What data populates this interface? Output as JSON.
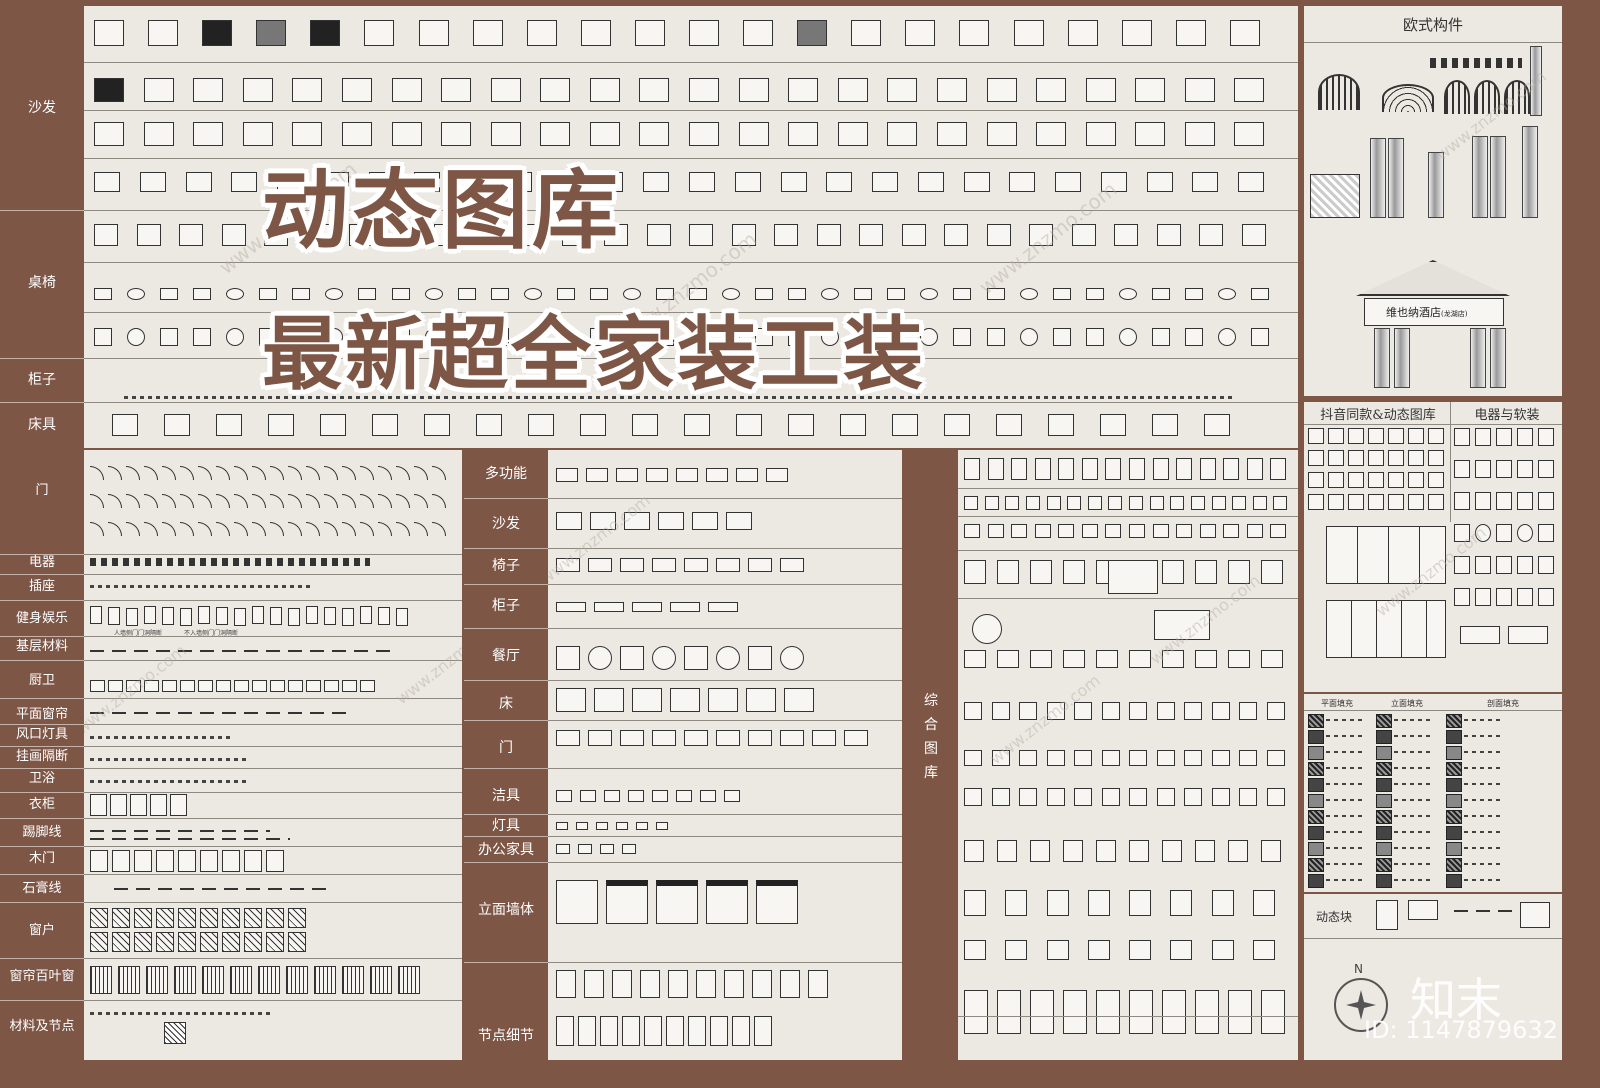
{
  "hero": {
    "line1": "动态图库",
    "line2": "最新超全家装工装"
  },
  "topleft_labels": [
    "沙发",
    "桌椅",
    "柜子",
    "床具"
  ],
  "midleft_labels": [
    "门",
    "电器",
    "插座",
    "健身娱乐",
    "基层材料",
    "厨卫",
    "平面窗帘",
    "风口灯具",
    "挂画隔断",
    "卫浴",
    "衣柜",
    "踢脚线",
    "木门",
    "石膏线",
    "窗户",
    "窗帘百叶窗",
    "材料及节点"
  ],
  "middle_labels": [
    "多功能",
    "沙发",
    "椅子",
    "柜子",
    "餐厅",
    "床",
    "门",
    "洁具",
    "灯具",
    "办公家具",
    "立面墙体",
    "节点细节"
  ],
  "mid_sign": [
    "综",
    "合",
    "图",
    "库"
  ],
  "right_titles": {
    "european": "欧式构件",
    "douyin": "抖音同款&动态图库",
    "appliances": "电器与软装",
    "dynamic_block": "动态块"
  },
  "hotel_sign": "维也纳酒店",
  "hotel_sub": "(龙湖店)",
  "fill_headers": [
    "平面填充",
    "立面填充",
    "剖面填充"
  ],
  "gym_captions": [
    "人墙侧门门洞隔断",
    "不入墙侧门门洞隔断"
  ],
  "watermark": "www.znzmo.com",
  "brand": "知末",
  "id_text": "ID: 1147879632",
  "compass_letter": "N",
  "colors": {
    "brand": "#7d5646",
    "panel": "#ece9e2",
    "ink": "#333333"
  }
}
